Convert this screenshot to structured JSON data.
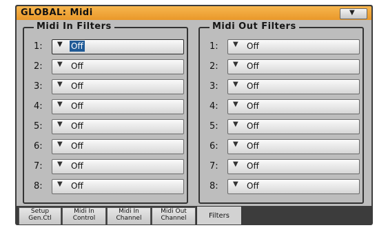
{
  "window": {
    "title": "GLOBAL: Midi"
  },
  "midi_in": {
    "title": "Midi In Filters",
    "rows": [
      {
        "num": "1:",
        "value": "Off"
      },
      {
        "num": "2:",
        "value": "Off"
      },
      {
        "num": "3:",
        "value": "Off"
      },
      {
        "num": "4:",
        "value": "Off"
      },
      {
        "num": "5:",
        "value": "Off"
      },
      {
        "num": "6:",
        "value": "Off"
      },
      {
        "num": "7:",
        "value": "Off"
      },
      {
        "num": "8:",
        "value": "Off"
      }
    ]
  },
  "midi_out": {
    "title": "Midi Out Filters",
    "rows": [
      {
        "num": "1:",
        "value": "Off"
      },
      {
        "num": "2:",
        "value": "Off"
      },
      {
        "num": "3:",
        "value": "Off"
      },
      {
        "num": "4:",
        "value": "Off"
      },
      {
        "num": "5:",
        "value": "Off"
      },
      {
        "num": "6:",
        "value": "Off"
      },
      {
        "num": "7:",
        "value": "Off"
      },
      {
        "num": "8:",
        "value": "Off"
      }
    ]
  },
  "tabs": [
    {
      "line1": "Setup",
      "line2": "Gen.Ctl"
    },
    {
      "line1": "Midi In",
      "line2": "Control"
    },
    {
      "line1": "Midi In",
      "line2": "Channel"
    },
    {
      "line1": "Midi Out",
      "line2": "Channel"
    },
    {
      "line1": "Filters",
      "line2": ""
    }
  ],
  "colors": {
    "title_bar": "#f0a43a",
    "panel": "#bdbdbd",
    "frame": "#3c3c3c",
    "selection": "#1f5a96"
  }
}
